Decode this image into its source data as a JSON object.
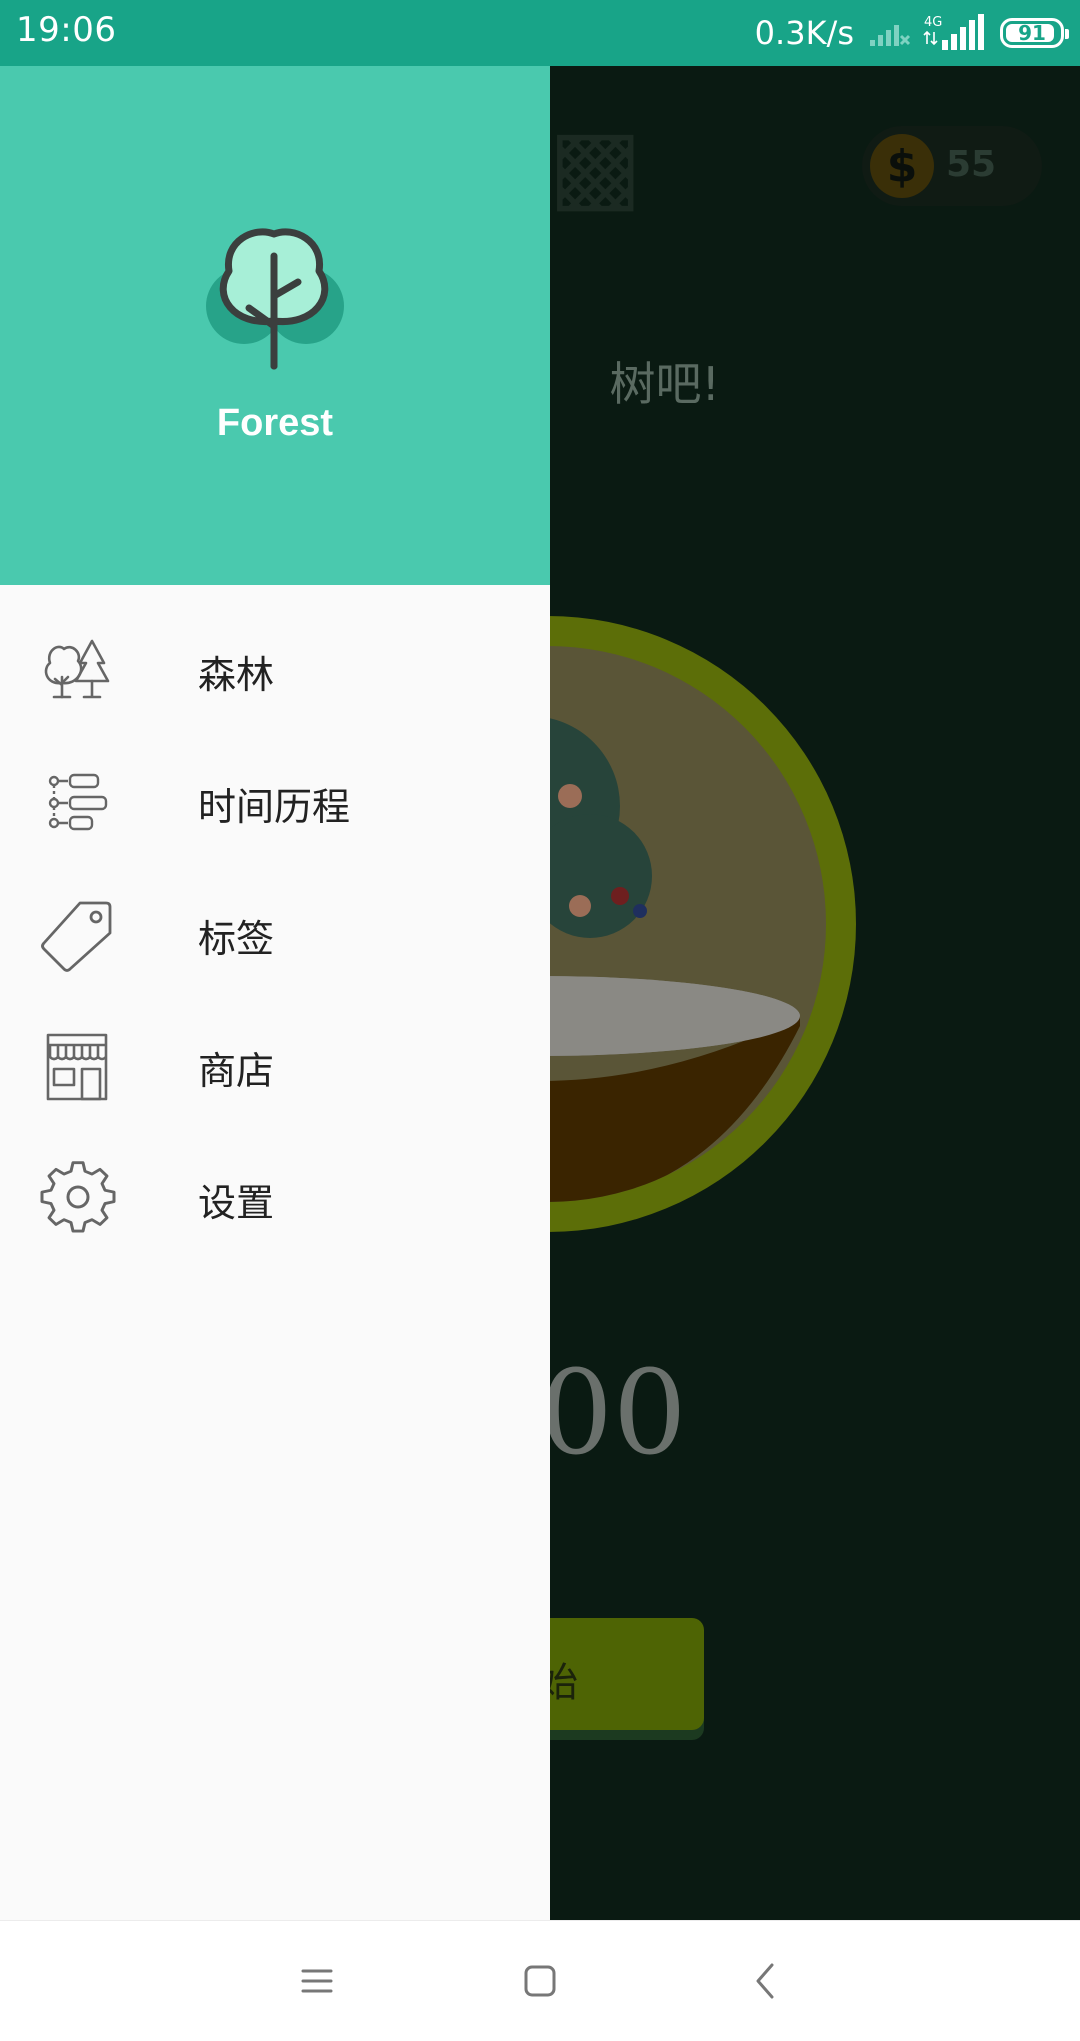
{
  "status_bar": {
    "time": "19:06",
    "net_speed": "0.3K/s",
    "network_type": "4G",
    "battery_level": "91",
    "icons": [
      "wifi-signal-icon",
      "cell-signal-icon",
      "battery-icon"
    ]
  },
  "background_app": {
    "prompt": "树吧!",
    "coin_count": "55",
    "coin_symbol": "$",
    "timer": ":00",
    "start_label": "始"
  },
  "drawer": {
    "app_name": "Forest",
    "logo_icon": "tree-logo-icon",
    "menu": [
      {
        "label": "森林",
        "icon": "forest-icon"
      },
      {
        "label": "时间历程",
        "icon": "timeline-icon"
      },
      {
        "label": "标签",
        "icon": "tag-icon"
      },
      {
        "label": "商店",
        "icon": "store-icon"
      },
      {
        "label": "设置",
        "icon": "gear-icon"
      }
    ]
  },
  "nav_bar": {
    "buttons": [
      "menu-icon",
      "home-icon",
      "back-icon"
    ]
  },
  "colors": {
    "status_bar": "#18a488",
    "drawer_header": "#4ac9ae",
    "drawer_body": "#fafafa",
    "menu_text": "#222222",
    "icon_stroke": "#666666"
  }
}
